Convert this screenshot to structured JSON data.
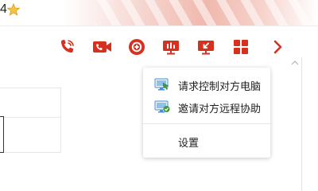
{
  "title": {
    "number_fragment": "4"
  },
  "toolbar": {
    "accent_color": "#d6311f",
    "tools": [
      {
        "icon": "phone-call-icon"
      },
      {
        "icon": "video-camera-icon"
      },
      {
        "icon": "add-contact-icon"
      },
      {
        "icon": "screen-share-presentation-icon"
      },
      {
        "icon": "remote-screen-icon"
      },
      {
        "icon": "apps-grid-icon"
      },
      {
        "icon": "chevron-right-icon"
      }
    ]
  },
  "menu": {
    "items": [
      {
        "label": "请求控制对方电脑",
        "icon": "request-control-icon"
      },
      {
        "label": "邀请对方远程协助",
        "icon": "invite-assist-icon"
      },
      {
        "label": "设置",
        "icon": ""
      }
    ]
  }
}
